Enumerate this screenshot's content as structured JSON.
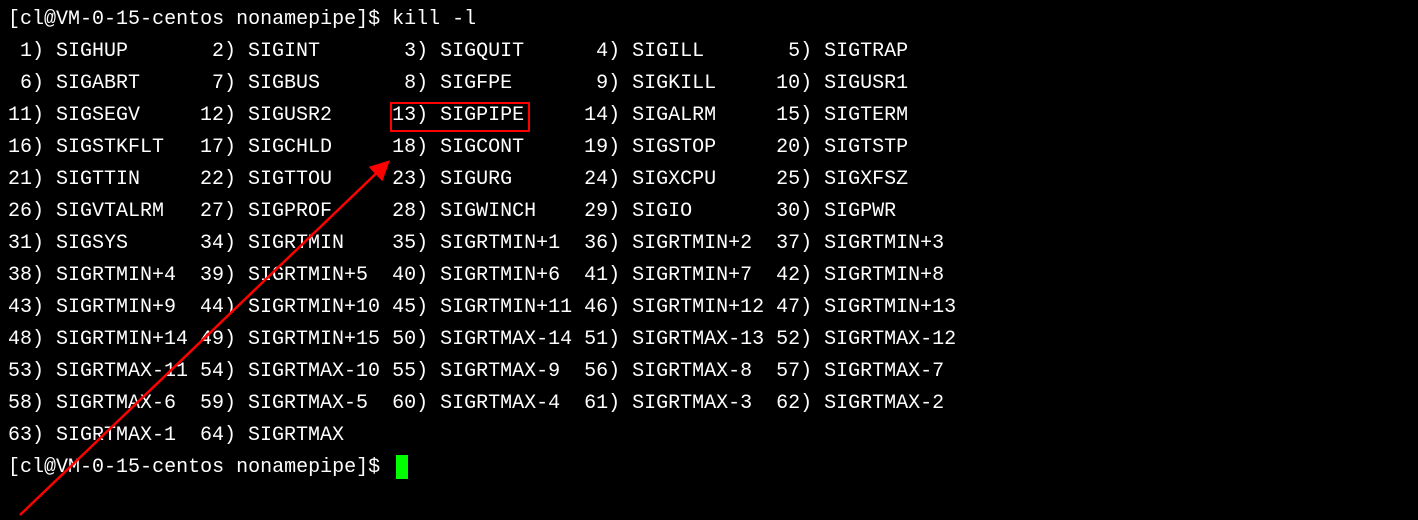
{
  "prompt": {
    "user": "cl",
    "host": "VM-0-15-centos",
    "path": "nonamepipe",
    "symbol": "$",
    "command": "kill -l"
  },
  "signals": [
    [
      {
        "n": "1",
        "name": "SIGHUP"
      },
      {
        "n": "2",
        "name": "SIGINT"
      },
      {
        "n": "3",
        "name": "SIGQUIT"
      },
      {
        "n": "4",
        "name": "SIGILL"
      },
      {
        "n": "5",
        "name": "SIGTRAP"
      }
    ],
    [
      {
        "n": "6",
        "name": "SIGABRT"
      },
      {
        "n": "7",
        "name": "SIGBUS"
      },
      {
        "n": "8",
        "name": "SIGFPE"
      },
      {
        "n": "9",
        "name": "SIGKILL"
      },
      {
        "n": "10",
        "name": "SIGUSR1"
      }
    ],
    [
      {
        "n": "11",
        "name": "SIGSEGV"
      },
      {
        "n": "12",
        "name": "SIGUSR2"
      },
      {
        "n": "13",
        "name": "SIGPIPE"
      },
      {
        "n": "14",
        "name": "SIGALRM"
      },
      {
        "n": "15",
        "name": "SIGTERM"
      }
    ],
    [
      {
        "n": "16",
        "name": "SIGSTKFLT"
      },
      {
        "n": "17",
        "name": "SIGCHLD"
      },
      {
        "n": "18",
        "name": "SIGCONT"
      },
      {
        "n": "19",
        "name": "SIGSTOP"
      },
      {
        "n": "20",
        "name": "SIGTSTP"
      }
    ],
    [
      {
        "n": "21",
        "name": "SIGTTIN"
      },
      {
        "n": "22",
        "name": "SIGTTOU"
      },
      {
        "n": "23",
        "name": "SIGURG"
      },
      {
        "n": "24",
        "name": "SIGXCPU"
      },
      {
        "n": "25",
        "name": "SIGXFSZ"
      }
    ],
    [
      {
        "n": "26",
        "name": "SIGVTALRM"
      },
      {
        "n": "27",
        "name": "SIGPROF"
      },
      {
        "n": "28",
        "name": "SIGWINCH"
      },
      {
        "n": "29",
        "name": "SIGIO"
      },
      {
        "n": "30",
        "name": "SIGPWR"
      }
    ],
    [
      {
        "n": "31",
        "name": "SIGSYS"
      },
      {
        "n": "34",
        "name": "SIGRTMIN"
      },
      {
        "n": "35",
        "name": "SIGRTMIN+1"
      },
      {
        "n": "36",
        "name": "SIGRTMIN+2"
      },
      {
        "n": "37",
        "name": "SIGRTMIN+3"
      }
    ],
    [
      {
        "n": "38",
        "name": "SIGRTMIN+4"
      },
      {
        "n": "39",
        "name": "SIGRTMIN+5"
      },
      {
        "n": "40",
        "name": "SIGRTMIN+6"
      },
      {
        "n": "41",
        "name": "SIGRTMIN+7"
      },
      {
        "n": "42",
        "name": "SIGRTMIN+8"
      }
    ],
    [
      {
        "n": "43",
        "name": "SIGRTMIN+9"
      },
      {
        "n": "44",
        "name": "SIGRTMIN+10"
      },
      {
        "n": "45",
        "name": "SIGRTMIN+11"
      },
      {
        "n": "46",
        "name": "SIGRTMIN+12"
      },
      {
        "n": "47",
        "name": "SIGRTMIN+13"
      }
    ],
    [
      {
        "n": "48",
        "name": "SIGRTMIN+14"
      },
      {
        "n": "49",
        "name": "SIGRTMIN+15"
      },
      {
        "n": "50",
        "name": "SIGRTMAX-14"
      },
      {
        "n": "51",
        "name": "SIGRTMAX-13"
      },
      {
        "n": "52",
        "name": "SIGRTMAX-12"
      }
    ],
    [
      {
        "n": "53",
        "name": "SIGRTMAX-11"
      },
      {
        "n": "54",
        "name": "SIGRTMAX-10"
      },
      {
        "n": "55",
        "name": "SIGRTMAX-9"
      },
      {
        "n": "56",
        "name": "SIGRTMAX-8"
      },
      {
        "n": "57",
        "name": "SIGRTMAX-7"
      }
    ],
    [
      {
        "n": "58",
        "name": "SIGRTMAX-6"
      },
      {
        "n": "59",
        "name": "SIGRTMAX-5"
      },
      {
        "n": "60",
        "name": "SIGRTMAX-4"
      },
      {
        "n": "61",
        "name": "SIGRTMAX-3"
      },
      {
        "n": "62",
        "name": "SIGRTMAX-2"
      }
    ],
    [
      {
        "n": "63",
        "name": "SIGRTMAX-1"
      },
      {
        "n": "64",
        "name": "SIGRTMAX"
      }
    ]
  ],
  "column_width_chars": 16,
  "highlight": {
    "row": 2,
    "col": 2,
    "signal_num": "13",
    "signal_name": "SIGPIPE"
  },
  "annotation_color": "#ff0000"
}
